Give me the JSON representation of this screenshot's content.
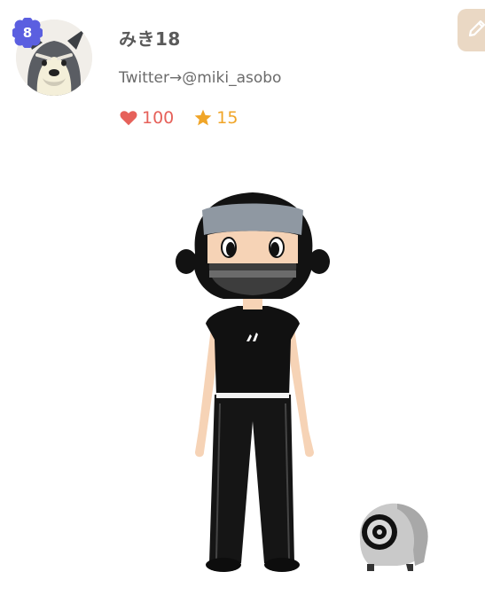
{
  "profile": {
    "username": "みき18",
    "bio": "Twitter→@miki_asobo",
    "level": "8",
    "avatar_icon": "schnauzer-dog-avatar"
  },
  "stats": {
    "likes": "100",
    "likes_icon": "heart-icon",
    "stars": "15",
    "stars_icon": "star-icon"
  },
  "actions": {
    "edit_icon": "pencil-icon"
  },
  "colors": {
    "level_badge": "#5b5fe0",
    "heart": "#e6615a",
    "star": "#f0a528",
    "edit_button_bg": "#ead8c4"
  }
}
